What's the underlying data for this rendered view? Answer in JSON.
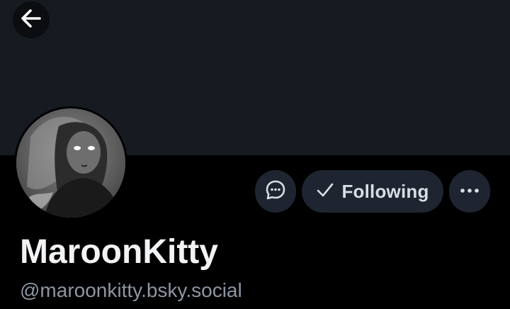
{
  "profile": {
    "display_name": "MaroonKitty",
    "handle": "@maroonkitty.bsky.social"
  },
  "actions": {
    "following_label": "Following"
  },
  "icons": {
    "back": "arrow-left-icon",
    "message": "chat-bubble-icon",
    "following": "checkmark-icon",
    "more": "ellipsis-icon"
  },
  "colors": {
    "banner": "#161b22",
    "background": "#000000",
    "button_bg": "#1e2530",
    "button_text": "#d9dde3",
    "name_text": "#f1f3f5",
    "handle_text": "#8d96a2"
  }
}
